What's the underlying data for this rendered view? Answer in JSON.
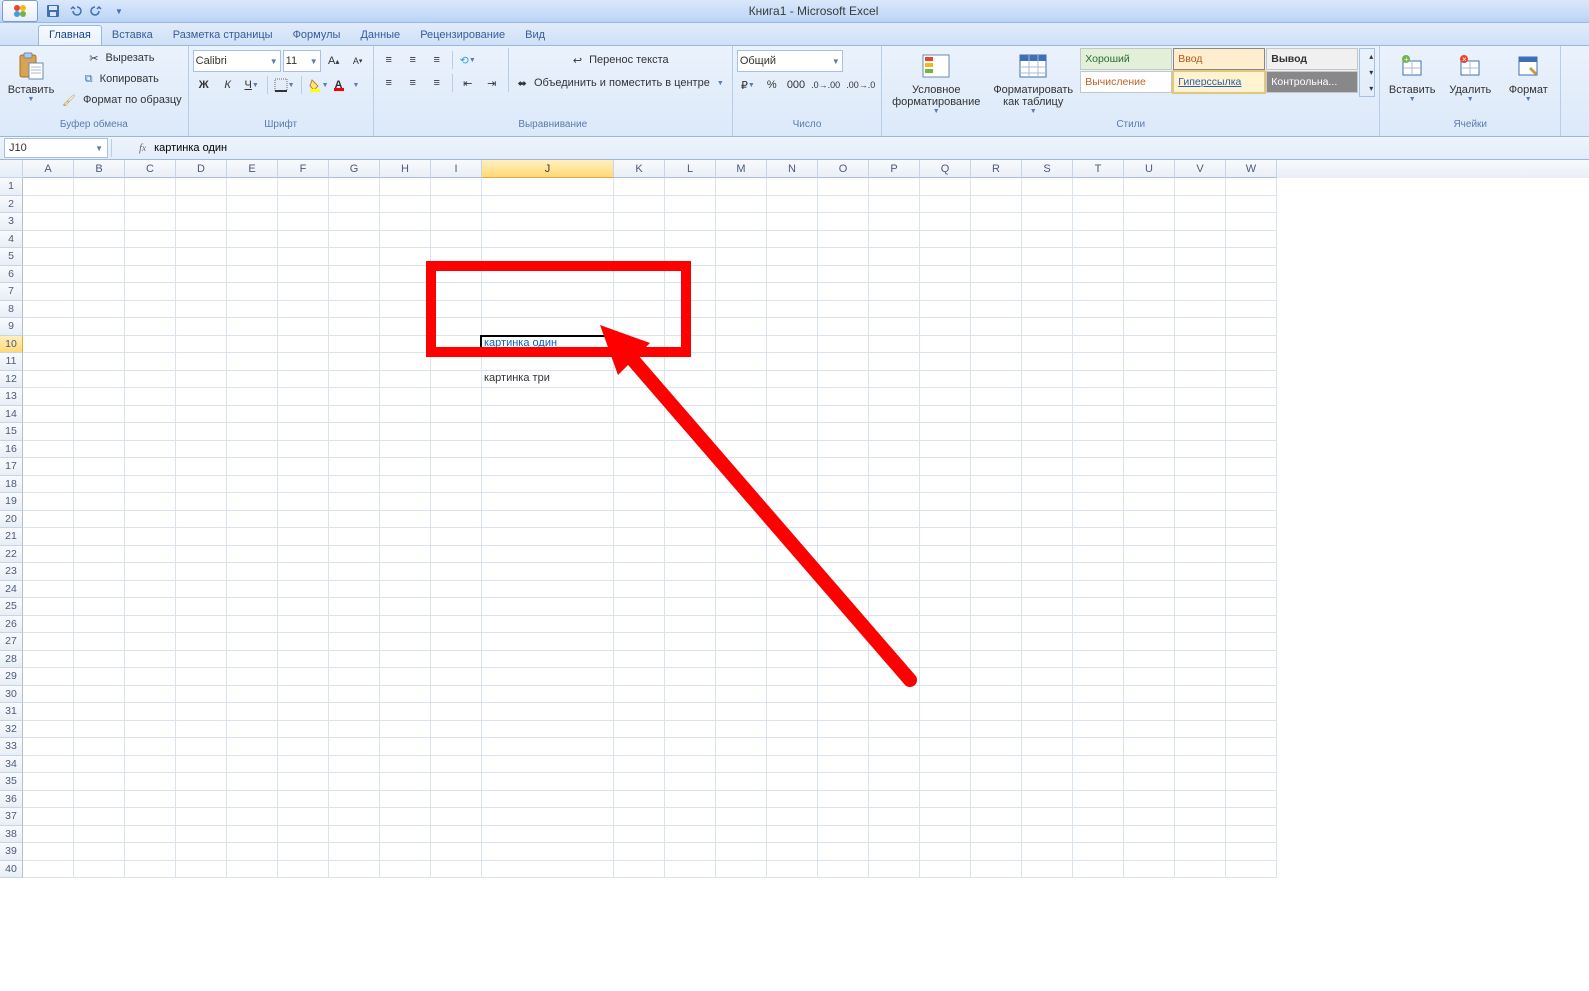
{
  "title": "Книга1 - Microsoft Excel",
  "tabs": [
    "Главная",
    "Вставка",
    "Разметка страницы",
    "Формулы",
    "Данные",
    "Рецензирование",
    "Вид"
  ],
  "active_tab": 0,
  "ribbon": {
    "clipboard": {
      "paste": "Вставить",
      "cut": "Вырезать",
      "copy": "Копировать",
      "format_painter": "Формат по образцу",
      "label": "Буфер обмена"
    },
    "font": {
      "name": "Calibri",
      "size": "11",
      "bold": "Ж",
      "italic": "К",
      "underline": "Ч",
      "label": "Шрифт"
    },
    "alignment": {
      "wrap": "Перенос текста",
      "merge": "Объединить и поместить в центре",
      "label": "Выравнивание"
    },
    "number": {
      "format": "Общий",
      "label": "Число"
    },
    "styles": {
      "conditional": "Условное форматирование",
      "as_table": "Форматировать как таблицу",
      "good": "Хороший",
      "input": "Ввод",
      "output": "Вывод",
      "calc": "Вычисление",
      "link": "Гиперссылка",
      "check": "Контрольна...",
      "label": "Стили"
    },
    "cells": {
      "insert": "Вставить",
      "delete": "Удалить",
      "format": "Формат",
      "label": "Ячейки"
    }
  },
  "namebox": "J10",
  "formula": "картинка один",
  "columns": [
    "A",
    "B",
    "C",
    "D",
    "E",
    "F",
    "G",
    "H",
    "I",
    "J",
    "K",
    "L",
    "M",
    "N",
    "O",
    "P",
    "Q",
    "R",
    "S",
    "T",
    "U",
    "V",
    "W"
  ],
  "selected_col_index": 9,
  "selected_row": 10,
  "row_count": 40,
  "col_width_default": 51,
  "col_width_selected": 132,
  "cells": {
    "J10": {
      "text": "картинка один",
      "hyperlink": true
    },
    "J12": {
      "text": "картинка три"
    }
  }
}
